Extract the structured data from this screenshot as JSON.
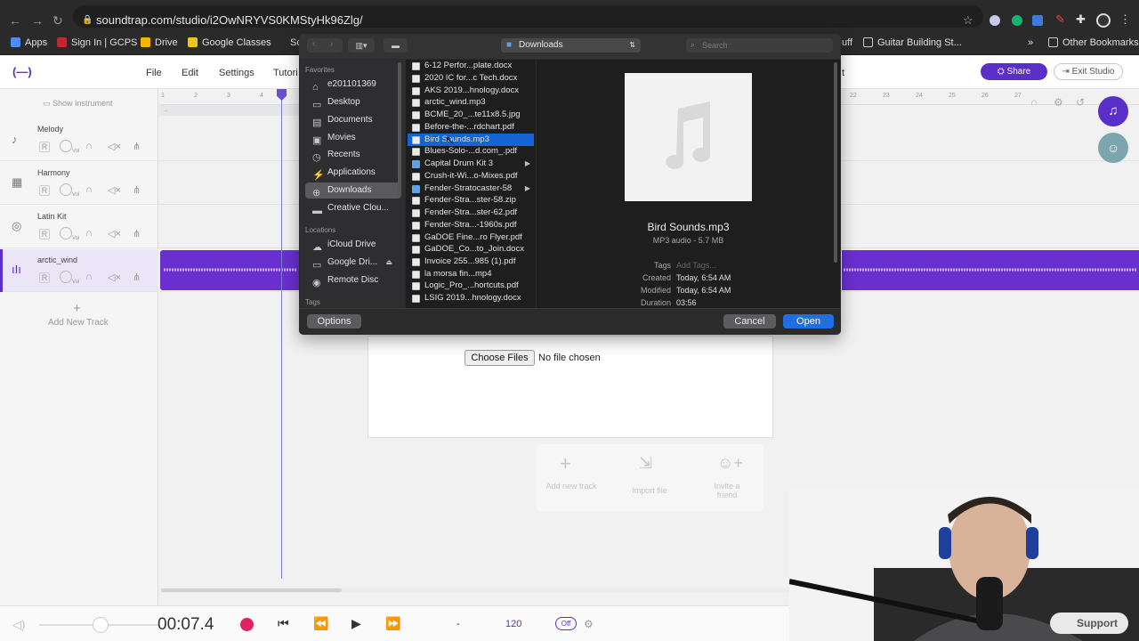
{
  "browser": {
    "url": "soundtrap.com/studio/i2OwNRYVS0KMStyHk96Zlg/",
    "bookmarks": [
      "Apps",
      "Sign In | GCPS",
      "Drive",
      "Google Classes",
      "Sc",
      "uff",
      "Guitar Building St...",
      "»",
      "Other Bookmarks"
    ]
  },
  "app": {
    "logo": "(—)",
    "menu": [
      "File",
      "Edit",
      "Settings",
      "Tutori"
    ],
    "menu_tail": "t",
    "share_label": "Share",
    "exit_label": "Exit Studio",
    "show_instrument": "Show Instrument",
    "ruler_ticks": [
      "1",
      "2",
      "3",
      "4",
      "22",
      "23",
      "24",
      "25",
      "26",
      "27"
    ],
    "tracks": [
      {
        "name": "Melody",
        "icon": "guitar-icon"
      },
      {
        "name": "Harmony",
        "icon": "keyboard-icon"
      },
      {
        "name": "Latin Kit",
        "icon": "drum-icon"
      },
      {
        "name": "arctic_wind",
        "icon": "waveform-icon"
      }
    ],
    "track_controls": {
      "record": "R",
      "vol": "Vol"
    },
    "add_track": "Add New Track",
    "upload": {
      "choose_label": "Choose Files",
      "no_file": "No file chosen",
      "actions": [
        "Add new track",
        "Import file",
        "Invite a friend"
      ]
    },
    "transport": {
      "time": "00:07.4",
      "dash": "-",
      "tempo": "120",
      "metronome": "Off",
      "support_label": "Support"
    }
  },
  "file_dialog": {
    "location": "Downloads",
    "search_placeholder": "Search",
    "favorites_header": "Favorites",
    "favorites": [
      {
        "label": "e201101369",
        "icon": "home-icon"
      },
      {
        "label": "Desktop",
        "icon": "desktop-icon"
      },
      {
        "label": "Documents",
        "icon": "document-icon"
      },
      {
        "label": "Movies",
        "icon": "film-icon"
      },
      {
        "label": "Recents",
        "icon": "clock-icon"
      },
      {
        "label": "Applications",
        "icon": "applications-icon"
      },
      {
        "label": "Downloads",
        "icon": "download-icon"
      },
      {
        "label": "Creative Clou...",
        "icon": "folder-icon"
      }
    ],
    "locations_header": "Locations",
    "locations": [
      {
        "label": "iCloud Drive",
        "icon": "cloud-icon"
      },
      {
        "label": "Google Dri...",
        "icon": "drive-icon"
      },
      {
        "label": "Remote Disc",
        "icon": "disc-icon"
      }
    ],
    "tags_header": "Tags",
    "files": [
      {
        "name": "6-12 Perfor...plate.docx",
        "kind": "file"
      },
      {
        "name": "2020 IC for...c Tech.docx",
        "kind": "file"
      },
      {
        "name": "AKS 2019...hnology.docx",
        "kind": "file"
      },
      {
        "name": "arctic_wind.mp3",
        "kind": "file"
      },
      {
        "name": "BCME_20_...te11x8.5.jpg",
        "kind": "file"
      },
      {
        "name": "Before-the-...rdchart.pdf",
        "kind": "file"
      },
      {
        "name": "Bird Sounds.mp3",
        "kind": "file",
        "selected": true
      },
      {
        "name": "Blues-Solo-...d.com_.pdf",
        "kind": "file"
      },
      {
        "name": "Capital Drum Kit 3",
        "kind": "folder"
      },
      {
        "name": "Crush-it-Wi...o-Mixes.pdf",
        "kind": "file"
      },
      {
        "name": "Fender-Stratocaster-58",
        "kind": "folder"
      },
      {
        "name": "Fender-Stra...ster-58.zip",
        "kind": "file"
      },
      {
        "name": "Fender-Stra...ster-62.pdf",
        "kind": "file"
      },
      {
        "name": "Fender-Stra...-1960s.pdf",
        "kind": "file"
      },
      {
        "name": "GaDOE Fine...ro Flyer.pdf",
        "kind": "file"
      },
      {
        "name": "GaDOE_Co...to_Join.docx",
        "kind": "file"
      },
      {
        "name": "Invoice 255...985 (1).pdf",
        "kind": "file"
      },
      {
        "name": "la morsa fin...mp4",
        "kind": "file"
      },
      {
        "name": "Logic_Pro_...hortcuts.pdf",
        "kind": "file"
      },
      {
        "name": "LSIG 2019...hnology.docx",
        "kind": "file"
      }
    ],
    "preview": {
      "filename": "Bird Sounds.mp3",
      "kind": "MP3 audio - 5.7 MB",
      "tags_label": "Tags",
      "tags_value": "Add Tags...",
      "created_label": "Created",
      "created_value": "Today, 6:54 AM",
      "modified_label": "Modified",
      "modified_value": "Today, 6:54 AM",
      "duration_label": "Duration",
      "duration_value": "03:56"
    },
    "options_label": "Options",
    "cancel_label": "Cancel",
    "open_label": "Open"
  },
  "colors": {
    "accent": "#5a2ec9",
    "clip": "#6a2fcf",
    "mac_blue": "#1464d6",
    "record": "#e0245e"
  }
}
